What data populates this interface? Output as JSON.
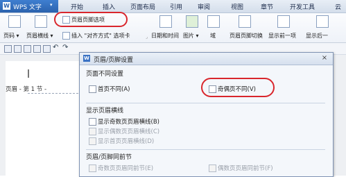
{
  "app": {
    "name": "WPS 文字",
    "logo_letter": "W",
    "arrow": "▾"
  },
  "menu": [
    "开始",
    "插入",
    "页面布局",
    "引用",
    "审阅",
    "视图",
    "章节",
    "开发工具",
    "云"
  ],
  "ribbon": {
    "header_footer_options": "页眉页脚选项",
    "page_number": "页码 ▾",
    "header_line": "页眉横线 ▾",
    "insert_align_tab": "插入 \"对齐方式\" 选项卡",
    "date_time": "日期和时间",
    "picture": "图片 ▾",
    "field": "域",
    "switch_header_footer": "页眉页脚切换",
    "show_previous": "显示前一项",
    "show_next": "显示后一"
  },
  "document": {
    "header_label": "页眉 - 第 1 节 -"
  },
  "dialog": {
    "title": "页眉/页脚设置",
    "close": "×",
    "group_different": "页面不同设置",
    "first_page_different": "首页不同(A)",
    "odd_even_different": "奇偶页不同(V)",
    "group_header_line": "显示页眉横线",
    "show_odd_header_line": "显示奇数页页眉横线(B)",
    "show_even_header_line": "显示偶数页页眉横线(C)",
    "show_first_header_line": "显示首页页眉横线(D)",
    "group_link": "页眉/页脚同前节",
    "odd_header_same": "奇数页页眉同前节(E)",
    "even_header_same": "偶数页页眉同前节(F)"
  }
}
